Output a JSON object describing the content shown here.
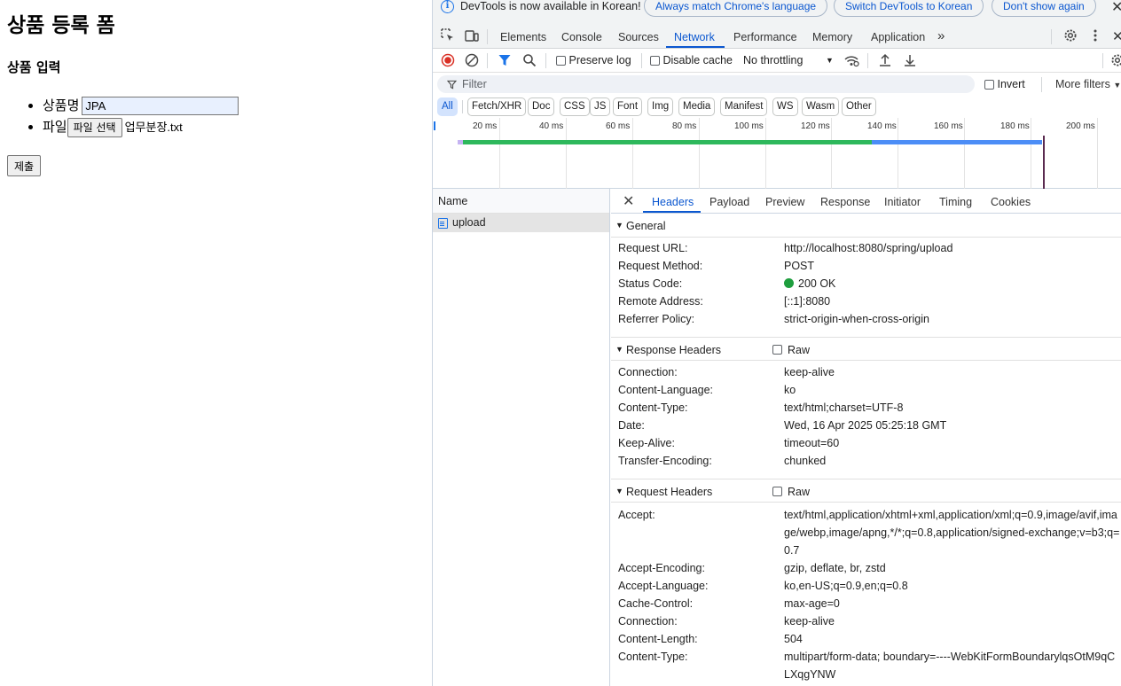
{
  "page": {
    "title": "상품 등록 폼",
    "subtitle": "상품 입력",
    "fields": {
      "name_label": "상품명",
      "name_value": "JPA",
      "file_label": "파일",
      "file_button": "파일 선택",
      "file_name": "업무분장.txt"
    },
    "submit_label": "제출"
  },
  "devtools": {
    "infobar": {
      "message": "DevTools is now available in Korean!",
      "buttons": [
        "Always match Chrome's language",
        "Switch DevTools to Korean",
        "Don't show again"
      ]
    },
    "tabs": [
      "Elements",
      "Console",
      "Sources",
      "Network",
      "Performance",
      "Memory",
      "Application"
    ],
    "active_tab": "Network",
    "toolbar": {
      "preserve_log": "Preserve log",
      "disable_cache": "Disable cache",
      "throttling": "No throttling"
    },
    "filter": {
      "placeholder": "Filter",
      "invert": "Invert",
      "more_filters": "More filters"
    },
    "type_chips": [
      "All",
      "Fetch/XHR",
      "Doc",
      "CSS",
      "JS",
      "Font",
      "Img",
      "Media",
      "Manifest",
      "WS",
      "Wasm",
      "Other"
    ],
    "timeline_ticks": [
      "20 ms",
      "40 ms",
      "60 ms",
      "80 ms",
      "100 ms",
      "120 ms",
      "140 ms",
      "160 ms",
      "180 ms",
      "200 ms"
    ],
    "request_list": {
      "header": "Name",
      "rows": [
        "upload"
      ]
    },
    "detail_tabs": [
      "Headers",
      "Payload",
      "Preview",
      "Response",
      "Initiator",
      "Timing",
      "Cookies"
    ],
    "general": {
      "title": "General",
      "rows": [
        {
          "key": "Request URL:",
          "value": "http://localhost:8080/spring/upload"
        },
        {
          "key": "Request Method:",
          "value": "POST"
        },
        {
          "key": "Status Code:",
          "value": "200 OK"
        },
        {
          "key": "Remote Address:",
          "value": "[::1]:8080"
        },
        {
          "key": "Referrer Policy:",
          "value": "strict-origin-when-cross-origin"
        }
      ]
    },
    "response_headers": {
      "title": "Response Headers",
      "raw": "Raw",
      "rows": [
        {
          "key": "Connection:",
          "value": "keep-alive"
        },
        {
          "key": "Content-Language:",
          "value": "ko"
        },
        {
          "key": "Content-Type:",
          "value": "text/html;charset=UTF-8"
        },
        {
          "key": "Date:",
          "value": "Wed, 16 Apr 2025 05:25:18 GMT"
        },
        {
          "key": "Keep-Alive:",
          "value": "timeout=60"
        },
        {
          "key": "Transfer-Encoding:",
          "value": "chunked"
        }
      ]
    },
    "request_headers": {
      "title": "Request Headers",
      "raw": "Raw",
      "rows": [
        {
          "key": "Accept:",
          "value": "text/html,application/xhtml+xml,application/xml;q=0.9,image/avif,image/webp,image/apng,*/*;q=0.8,application/signed-exchange;v=b3;q=0.7"
        },
        {
          "key": "Accept-Encoding:",
          "value": "gzip, deflate, br, zstd"
        },
        {
          "key": "Accept-Language:",
          "value": "ko,en-US;q=0.9,en;q=0.8"
        },
        {
          "key": "Cache-Control:",
          "value": "max-age=0"
        },
        {
          "key": "Connection:",
          "value": "keep-alive"
        },
        {
          "key": "Content-Length:",
          "value": "504"
        },
        {
          "key": "Content-Type:",
          "value": "multipart/form-data; boundary=----WebKitFormBoundarylqsOtM9qCLXqgYNW"
        }
      ]
    },
    "colors": {
      "accent": "#0b57d0",
      "status_ok": "#1e9e3e",
      "timeline_green": "#2eb85c",
      "timeline_blue": "#4c8df6"
    }
  }
}
